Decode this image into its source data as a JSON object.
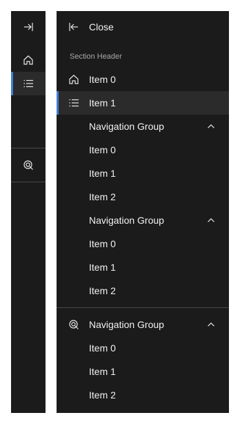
{
  "rail": {
    "items": [
      {
        "icon": "expand-icon"
      },
      {
        "icon": "home-icon"
      },
      {
        "icon": "list-icon"
      },
      {
        "icon": "target-search-icon"
      }
    ],
    "active_index": 2
  },
  "panel": {
    "close_label": "Close",
    "section_header": "Section Header",
    "items": [
      {
        "label": "Item 0",
        "icon": "home-icon"
      },
      {
        "label": "Item 1",
        "icon": "list-icon",
        "active": true
      }
    ],
    "groups": [
      {
        "label": "Navigation Group",
        "expanded": true,
        "items": [
          "Item 0",
          "Item 1",
          "Item 2"
        ]
      },
      {
        "label": "Navigation Group",
        "expanded": true,
        "items": [
          "Item 0",
          "Item 1",
          "Item 2"
        ]
      },
      {
        "label": "Navigation Group",
        "icon": "target-search-icon",
        "expanded": true,
        "items": [
          "Item 0",
          "Item 1",
          "Item 2"
        ]
      }
    ]
  },
  "colors": {
    "background": "#1c1b1b",
    "active_background": "#2c2b2b",
    "accent": "#3d7fd6",
    "text": "#f2f2f2",
    "muted_text": "#a8a8a8"
  }
}
